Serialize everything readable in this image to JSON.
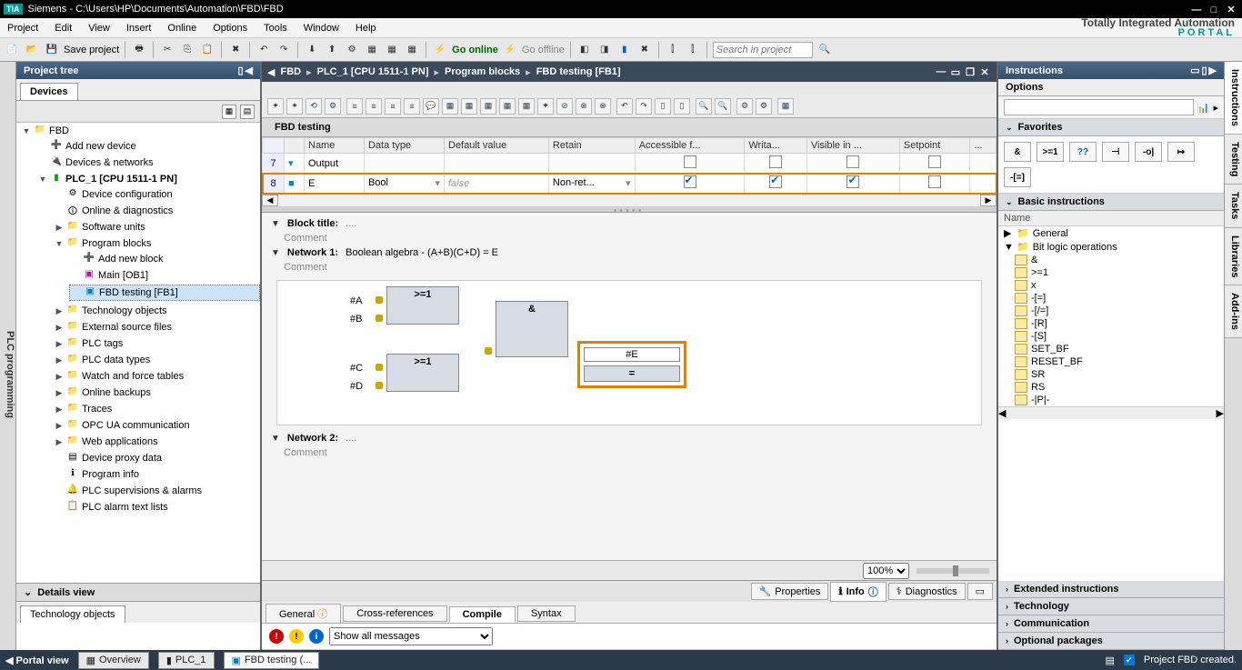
{
  "title": "Siemens  -  C:\\Users\\HP\\Documents\\Automation\\FBD\\FBD",
  "menu": [
    "Project",
    "Edit",
    "View",
    "Insert",
    "Online",
    "Options",
    "Tools",
    "Window",
    "Help"
  ],
  "brand": {
    "line1": "Totally Integrated Automation",
    "line2": "PORTAL"
  },
  "toolbar": {
    "save": "Save project",
    "goonline": "Go online",
    "gooffline": "Go offline",
    "search_ph": "Search in project"
  },
  "leftrail": "PLC programming",
  "projtree": {
    "title": "Project tree",
    "tab": "Devices",
    "root": "FBD",
    "items": [
      "Add new device",
      "Devices & networks",
      "PLC_1 [CPU 1511-1 PN]",
      "Device configuration",
      "Online & diagnostics",
      "Software units",
      "Program blocks",
      "Add new block",
      "Main [OB1]",
      "FBD testing [FB1]",
      "Technology objects",
      "External source files",
      "PLC tags",
      "PLC data types",
      "Watch and force tables",
      "Online backups",
      "Traces",
      "OPC UA communication",
      "Web applications",
      "Device proxy data",
      "Program info",
      "PLC supervisions & alarms",
      "PLC alarm text lists"
    ],
    "details": "Details view",
    "techtab": "Technology objects"
  },
  "breadcrumb": [
    "FBD",
    "PLC_1 [CPU 1511-1 PN]",
    "Program blocks",
    "FBD testing [FB1]"
  ],
  "blocktitle": "FBD testing",
  "iface": {
    "headers": [
      "",
      "Name",
      "Data type",
      "Default value",
      "Retain",
      "Accessible f...",
      "Writa...",
      "Visible in ...",
      "Setpoint",
      "..."
    ],
    "rows": [
      {
        "num": 7,
        "name": "Output",
        "dtype": "",
        "def": "",
        "retain": "",
        "acc": false,
        "wri": false,
        "vis": false,
        "sp": false,
        "group": true
      },
      {
        "num": 8,
        "name": "E",
        "dtype": "Bool",
        "def": "false",
        "retain": "Non-ret...",
        "acc": true,
        "wri": true,
        "vis": true,
        "sp": false,
        "hl": true
      }
    ]
  },
  "sections": {
    "blktitle": "Block title:",
    "comment": "Comment",
    "net1": "Network 1:",
    "net1desc": "Boolean algebra - (A+B)(C+D) = E",
    "net2": "Network 2:"
  },
  "fbd": {
    "a": "#A",
    "b": "#B",
    "c": "#C",
    "d": "#D",
    "g1": ">=1",
    "g2": ">=1",
    "g3": "&",
    "outtag": "#E",
    "outop": "="
  },
  "zoom": "100%",
  "proptabs": {
    "props": "Properties",
    "info": "Info",
    "diag": "Diagnostics"
  },
  "subtabs": [
    "General",
    "Cross-references",
    "Compile",
    "Syntax"
  ],
  "msgfilter": "Show all messages",
  "right": {
    "title": "Instructions",
    "options": "Options",
    "fav": "Favorites",
    "basic": "Basic instructions",
    "namecol": "Name",
    "groups": {
      "general": "General",
      "bitlogic": "Bit logic operations"
    },
    "ops": [
      "&",
      ">=1",
      "x",
      "-[=]",
      "-[/=]",
      "-[R]",
      "-[S]",
      "SET_BF",
      "RESET_BF",
      "SR",
      "RS",
      "-|P|-"
    ],
    "ext": "Extended instructions",
    "tech": "Technology",
    "comm": "Communication",
    "optp": "Optional packages",
    "favicons": [
      "&",
      ">=1",
      "??",
      "⊣",
      "-o|",
      "↦",
      "-[=]"
    ]
  },
  "rightrail": [
    "Instructions",
    "Testing",
    "Tasks",
    "Libraries",
    "Add-ins"
  ],
  "status": {
    "portal": "Portal view",
    "overview": "Overview",
    "plc": "PLC_1",
    "fbd": "FBD testing (...",
    "msg": "Project FBD created."
  }
}
